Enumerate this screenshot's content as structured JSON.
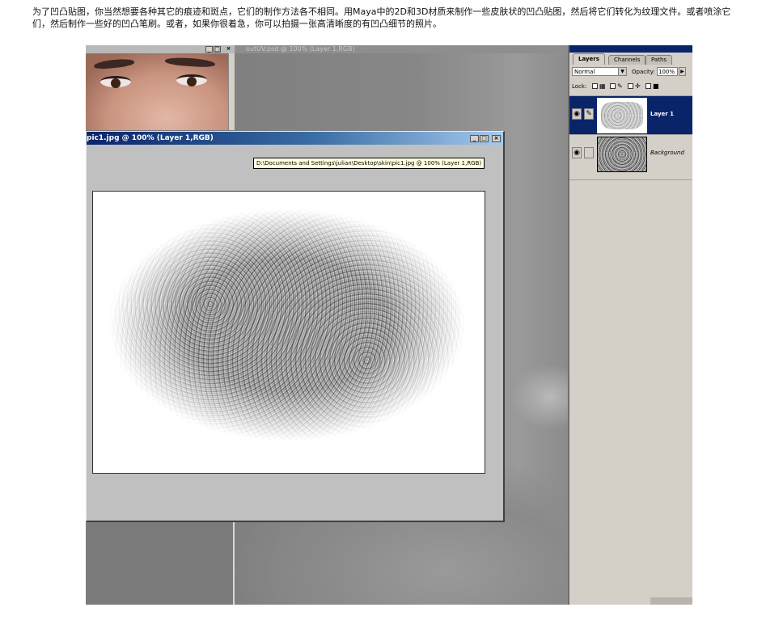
{
  "intro_text": "为了凹凸贴图，你当然想要各种其它的痕迹和斑点，它们的制作方法各不相同。用Maya中的2D和3D材质来制作一些皮肤状的凹凸贴图，然后将它们转化为纹理文件。或者喷涂它们，然后制作一些好的凹凸笔刷。或者，如果你很着急，你可以拍摄一张高清晰度的有凹凸细节的照片。",
  "bg_window": {
    "title": "outUV.psd @ 100% (Layer 1,RGB)"
  },
  "pic_window": {
    "title": "pic1.jpg @ 100% (Layer 1,RGB)",
    "tooltip": "D:\\Documents and Settings\\julian\\Desktop\\skin\\pic1.jpg @ 100% (Layer 1,RGB)"
  },
  "window_controls": {
    "minimize": "_",
    "maximize": "□",
    "close": "×"
  },
  "layers_panel": {
    "tabs": [
      {
        "label": "Layers",
        "active": true
      },
      {
        "label": "Channels",
        "active": false
      },
      {
        "label": "Paths",
        "active": false
      }
    ],
    "blend_mode": "Normal",
    "opacity_label": "Opacity:",
    "opacity_value": "100%",
    "lock_label": "Lock:",
    "layers": [
      {
        "name": "Layer 1",
        "selected": true
      },
      {
        "name": "Background",
        "selected": false
      }
    ]
  },
  "icons": {
    "eye": "eye-icon",
    "brush": "brush-icon",
    "lock_transparency": "checkerboard-icon",
    "lock_paint": "brush-icon",
    "lock_position": "move-icon",
    "lock_all": "padlock-icon",
    "dropdown": "chevron-down-icon",
    "flyout": "triangle-right-icon"
  },
  "colors": {
    "title_active_start": "#0a246a",
    "title_active_end": "#a6caf0",
    "panel_bg": "#d4d0c8",
    "workspace_bg": "#7b7b7b",
    "tooltip_bg": "#ffffe1"
  }
}
